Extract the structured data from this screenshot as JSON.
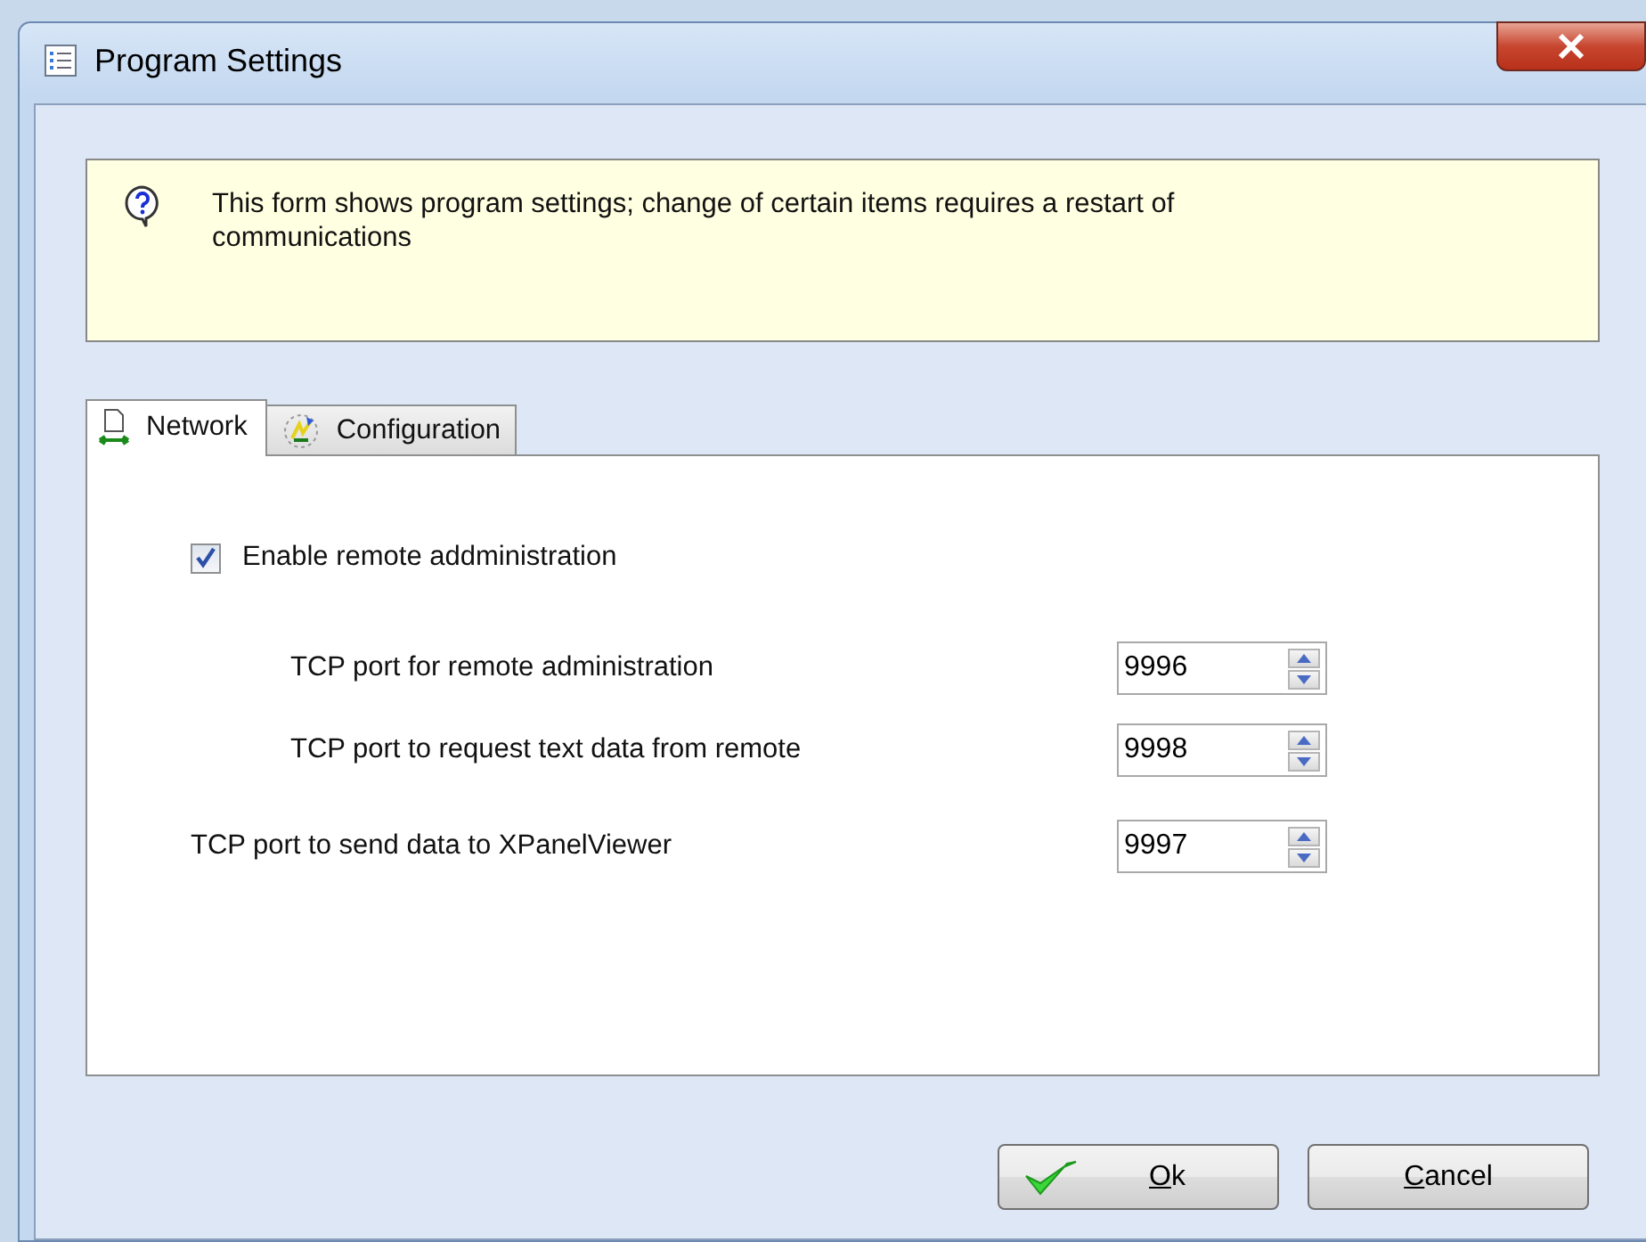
{
  "window": {
    "title": "Program Settings"
  },
  "info": {
    "text": "This form shows program settings; change of certain items requires a restart of communications"
  },
  "tabs": [
    {
      "label": "Network",
      "kind": "network",
      "selected": true
    },
    {
      "label": "Configuration",
      "kind": "config",
      "selected": false
    }
  ],
  "network": {
    "remote_admin": {
      "label": "Enable remote addministration",
      "checked": true
    },
    "ports": [
      {
        "label": "TCP port for remote administration",
        "value": "9996",
        "indented": true
      },
      {
        "label": "TCP port to request text data from remote",
        "value": "9998",
        "indented": true
      },
      {
        "label": "TCP port to send data to XPanelViewer",
        "value": "9997",
        "indented": false
      }
    ]
  },
  "buttons": [
    {
      "label": "Ok",
      "kind": "ok"
    },
    {
      "label": "Cancel",
      "kind": "cancel"
    }
  ]
}
